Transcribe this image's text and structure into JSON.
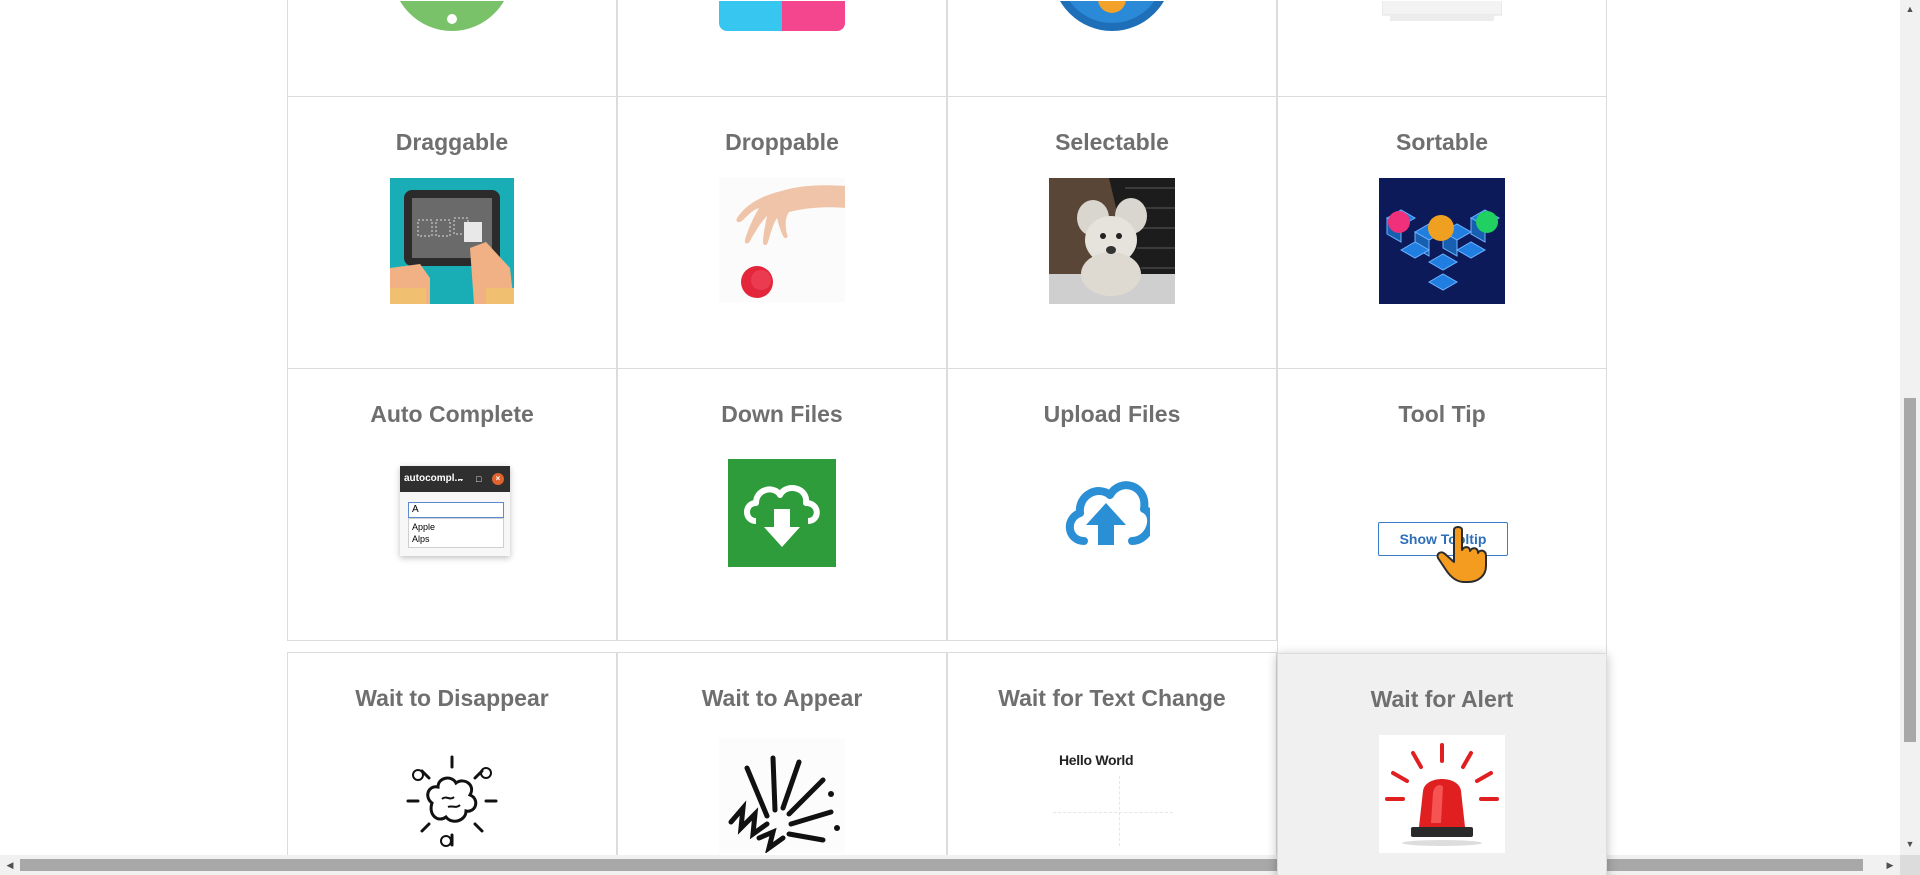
{
  "cards": {
    "draggable": {
      "title": "Draggable"
    },
    "droppable": {
      "title": "Droppable"
    },
    "selectable": {
      "title": "Selectable"
    },
    "sortable": {
      "title": "Sortable"
    },
    "autocomplete": {
      "title": "Auto Complete",
      "window_title": "autocompl...",
      "input_value": "A",
      "options": [
        "Apple",
        "Alps"
      ]
    },
    "download": {
      "title": "Down Files"
    },
    "upload": {
      "title": "Upload Files"
    },
    "tooltip": {
      "title": "Tool Tip",
      "button_label": "Show Tooltip"
    },
    "wait_disappear": {
      "title": "Wait to Disappear"
    },
    "wait_appear": {
      "title": "Wait to Appear"
    },
    "wait_text": {
      "title": "Wait for Text Change",
      "sample_text": "Hello World"
    },
    "wait_alert": {
      "title": "Wait for Alert"
    }
  },
  "colors": {
    "title": "#6f6f6f",
    "download_green": "#2e9c3a",
    "upload_blue": "#2b8fd6",
    "alert_red": "#e02020"
  },
  "icons": [
    "cursor-hand-icon",
    "cloud-download-icon",
    "cloud-upload-icon",
    "siren-icon"
  ]
}
